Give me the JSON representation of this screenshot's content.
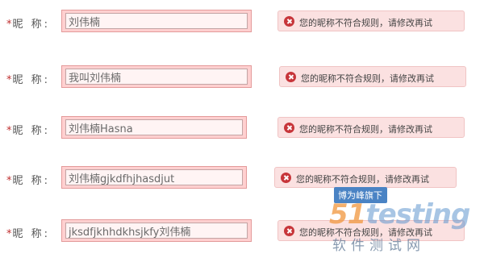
{
  "rows": [
    {
      "required": "*",
      "label": "昵 称:",
      "value": "刘伟楠",
      "error": "您的昵称不符合规则，请修改再试"
    },
    {
      "required": "*",
      "label": "昵 称:",
      "value": "我叫刘伟楠",
      "error": "您的昵称不符合规则，请修改再试"
    },
    {
      "required": "*",
      "label": "昵 称:",
      "value": "刘伟楠Hasna",
      "error": "您的昵称不符合规则，请修改再试"
    },
    {
      "required": "*",
      "label": "昵 称:",
      "value": "刘伟楠gjkdfhjhasdjut",
      "error": "您的昵称不符合规则，请修改再试"
    },
    {
      "required": "*",
      "label": "昵 称:",
      "value": "jksdfjkhhdkhsjkfy刘伟楠",
      "error": "您的昵称不符合规则，请修改再试"
    }
  ],
  "watermark": {
    "badge": "博为峰旗下",
    "logo_number": "51",
    "logo_text": "testing",
    "subtitle": "软件测试网"
  },
  "colors": {
    "field_bg": "#ffd0d0",
    "field_border": "#e39a9a",
    "error_bg": "#fbe1e1",
    "error_icon": "#c7353a",
    "required_mark": "#c03030"
  },
  "icons": {
    "error": "error-x-circle-icon"
  }
}
